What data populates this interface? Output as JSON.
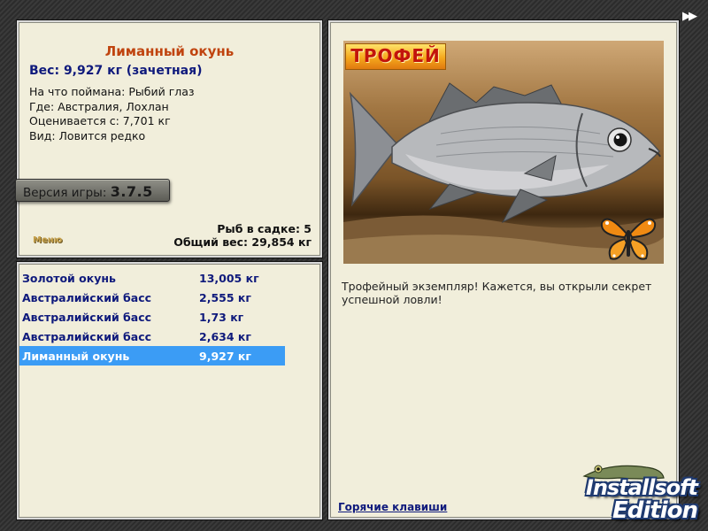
{
  "fish": {
    "name": "Лиманный окунь",
    "weight": "Вес: 9,927 кг (зачетная)",
    "details": [
      "На что поймана: Рыбий глаз",
      "Где: Австралия, Лохлан",
      "Оценивается с: 7,701 кг",
      "Вид: Ловится редко"
    ]
  },
  "version": {
    "label": "Версия игры:",
    "number": "3.7.5"
  },
  "menu_label": "Меню",
  "summary": {
    "count": "Рыб в садке: 5",
    "total": "Общий вес: 29,854 кг"
  },
  "catch_list": [
    {
      "name": "Золотой окунь",
      "weight": "13,005 кг",
      "selected": false
    },
    {
      "name": "Австралийский басс",
      "weight": "2,555 кг",
      "selected": false
    },
    {
      "name": "Австралийский басс",
      "weight": "1,73 кг",
      "selected": false
    },
    {
      "name": "Австралийский басс",
      "weight": "2,634 кг",
      "selected": false
    },
    {
      "name": "Лиманный окунь",
      "weight": "9,927 кг",
      "selected": true
    }
  ],
  "photo": {
    "badge": "ТРОФЕЙ"
  },
  "description": "Трофейный экземпляр! Кажется, вы открыли секрет успешной ловли!",
  "hotkeys_label": "Горячие клавиши",
  "fast_forward": "▶▶",
  "edition_logo": {
    "line1": "Installsoft",
    "line2": "Edition"
  },
  "colors": {
    "panel_bg": "#f1eedb",
    "title": "#c0440f",
    "text_blue": "#0f1a7c",
    "selection": "#3b9cf5"
  }
}
